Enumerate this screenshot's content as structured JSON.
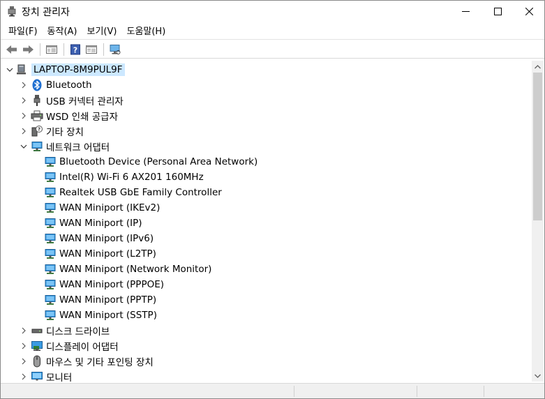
{
  "window": {
    "title": "장치 관리자",
    "minimize_label": "",
    "maximize_label": "",
    "close_label": ""
  },
  "menu": [
    {
      "label": "파일(F)"
    },
    {
      "label": "동작(A)"
    },
    {
      "label": "보기(V)"
    },
    {
      "label": "도움말(H)"
    }
  ],
  "toolbar": {
    "icons": [
      "back-arrow-icon",
      "forward-arrow-icon",
      "properties-icon",
      "help-icon",
      "details-pane-icon",
      "monitor-scan-icon"
    ]
  },
  "tree": {
    "root": {
      "label": "LAPTOP-8M9PUL9F",
      "icon": "computer-icon"
    },
    "categories_before": [
      {
        "label": "Bluetooth",
        "icon": "bluetooth-icon",
        "expanded": false
      },
      {
        "label": "USB 커넥터 관리자",
        "icon": "usb-connector-icon",
        "expanded": false
      },
      {
        "label": "WSD 인쇄 공급자",
        "icon": "printer-icon",
        "expanded": false
      },
      {
        "label": "기타 장치",
        "icon": "unknown-device-icon",
        "expanded": false
      }
    ],
    "network": {
      "label": "네트워크 어댑터",
      "icon": "network-adapter-icon",
      "expanded": true,
      "children": [
        "Bluetooth Device (Personal Area Network)",
        "Intel(R) Wi-Fi 6 AX201 160MHz",
        "Realtek USB GbE Family Controller",
        "WAN Miniport (IKEv2)",
        "WAN Miniport (IP)",
        "WAN Miniport (IPv6)",
        "WAN Miniport (L2TP)",
        "WAN Miniport (Network Monitor)",
        "WAN Miniport (PPPOE)",
        "WAN Miniport (PPTP)",
        "WAN Miniport (SSTP)"
      ]
    },
    "categories_after": [
      {
        "label": "디스크 드라이브",
        "icon": "disk-drive-icon",
        "expanded": false
      },
      {
        "label": "디스플레이 어댑터",
        "icon": "display-adapter-icon",
        "expanded": false
      },
      {
        "label": "마우스 및 기타 포인팅 장치",
        "icon": "mouse-icon",
        "expanded": false
      },
      {
        "label": "모니터",
        "icon": "monitor-icon",
        "expanded": false
      }
    ]
  },
  "colors": {
    "selection": "#cce8ff",
    "network_icon": "#2b88d8",
    "bluetooth": "#1f6fd1"
  }
}
